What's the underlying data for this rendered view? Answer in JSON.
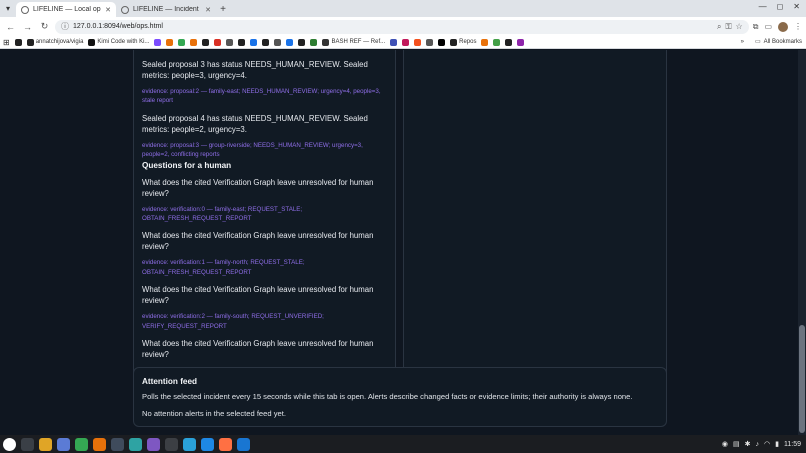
{
  "browser": {
    "tabs": [
      {
        "title": "LIFELINE — Local operations",
        "active": true
      },
      {
        "title": "LIFELINE — Incident room",
        "active": false
      }
    ],
    "url": "127.0.0.1:8094/web/ops.html",
    "bookmarks": [
      {
        "label": "",
        "color": "#222222"
      },
      {
        "label": "annatchijova/vigia",
        "color": "#222222"
      },
      {
        "label": "Kimi Code with Ki...",
        "color": "#111111"
      },
      {
        "label": "",
        "color": "#7c4dff"
      },
      {
        "label": "",
        "color": "#e8710a"
      },
      {
        "label": "",
        "color": "#34a853"
      },
      {
        "label": "",
        "color": "#e8710a"
      },
      {
        "label": "",
        "color": "#222222"
      },
      {
        "label": "",
        "color": "#d93025"
      },
      {
        "label": "",
        "color": "#555555"
      },
      {
        "label": "",
        "color": "#222222"
      },
      {
        "label": "",
        "color": "#1a73e8"
      },
      {
        "label": "",
        "color": "#222222"
      },
      {
        "label": "",
        "color": "#555555"
      },
      {
        "label": "",
        "color": "#1a73e8"
      },
      {
        "label": "",
        "color": "#222222"
      },
      {
        "label": "",
        "color": "#2e7d32"
      },
      {
        "label": "BASH REF — Ref...",
        "color": "#333333"
      },
      {
        "label": "",
        "color": "#3f51b5"
      },
      {
        "label": "",
        "color": "#c2185b"
      },
      {
        "label": "",
        "color": "#f4511e"
      },
      {
        "label": "",
        "color": "#555555"
      },
      {
        "label": "",
        "color": "#000000"
      },
      {
        "label": "Repos",
        "color": "#222222"
      },
      {
        "label": "",
        "color": "#e8710a"
      },
      {
        "label": "",
        "color": "#43a047"
      },
      {
        "label": "",
        "color": "#222222"
      },
      {
        "label": "",
        "color": "#8e24aa"
      }
    ],
    "all_bookmarks": "All Bookmarks"
  },
  "left_panel": {
    "entries": [
      {
        "kind": "stmt",
        "text": "Sealed proposal 3 has status NEEDS_HUMAN_REVIEW. Sealed metrics: people=3, urgency=4."
      },
      {
        "kind": "ev",
        "text": "evidence: proposal:2 — family-east; NEEDS_HUMAN_REVIEW; urgency=4, people=3, stale report"
      },
      {
        "kind": "stmt",
        "text": "Sealed proposal 4 has status NEEDS_HUMAN_REVIEW. Sealed metrics: people=2, urgency=3."
      },
      {
        "kind": "ev",
        "text": "evidence: proposal:3 — group-riverside; NEEDS_HUMAN_REVIEW; urgency=3, people=2, conflicting reports"
      },
      {
        "kind": "h2",
        "text": "Questions for a human"
      },
      {
        "kind": "stmt",
        "text": "What does the cited Verification Graph leave unresolved for human review?"
      },
      {
        "kind": "ev",
        "text": "evidence: verification:0 — family-east; REQUEST_STALE; OBTAIN_FRESH_REQUEST_REPORT"
      },
      {
        "kind": "stmt",
        "text": "What does the cited Verification Graph leave unresolved for human review?"
      },
      {
        "kind": "ev",
        "text": "evidence: verification:1 — family-north; REQUEST_STALE; OBTAIN_FRESH_REQUEST_REPORT"
      },
      {
        "kind": "stmt",
        "text": "What does the cited Verification Graph leave unresolved for human review?"
      },
      {
        "kind": "ev",
        "text": "evidence: verification:2 — family-south; REQUEST_UNVERIFIED; VERIFY_REQUEST_REPORT"
      },
      {
        "kind": "stmt",
        "text": "What does the cited Verification Graph leave unresolved for human review?"
      },
      {
        "kind": "ev",
        "text": "evidence: verification:3 — group-riverside; REQUEST_CONTRADICTION; OBTAIN_DISCRIMINATING_EVIDENCE"
      }
    ]
  },
  "attention_feed": {
    "title": "Attention feed",
    "description": "Polls the selected incident every 15 seconds while this tab is open. Alerts describe changed facts or evidence limits; their authority is always none.",
    "empty": "No attention alerts in the selected feed yet."
  },
  "taskbar": {
    "apps": [
      "#3a3f46",
      "#e0a526",
      "#5b7bd5",
      "#34a853",
      "#e8710a",
      "#3f4b5c",
      "#2ea3a3",
      "#7e57c2",
      "#3c3f44",
      "#2aa1d9",
      "#1e88e5",
      "#ff7043",
      "#1976d2"
    ],
    "time": "11:59"
  }
}
